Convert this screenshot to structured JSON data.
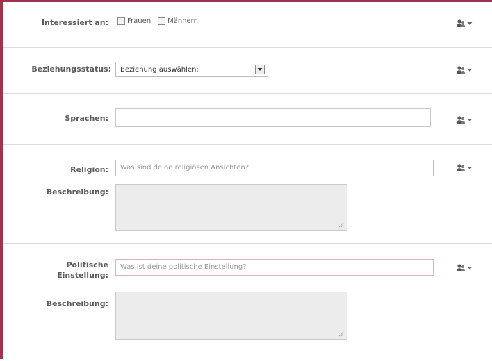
{
  "interested_in": {
    "label": "Interessiert an:",
    "options": [
      {
        "label": "Frauen",
        "checked": false
      },
      {
        "label": "Männern",
        "checked": false
      }
    ]
  },
  "relationship": {
    "label": "Beziehungsstatus:",
    "selected": "Beziehung auswählen:"
  },
  "languages": {
    "label": "Sprachen:",
    "value": ""
  },
  "religion": {
    "label": "Religion:",
    "placeholder": "Was sind deine religiösen Ansichten?",
    "description_label": "Beschreibung:"
  },
  "politics": {
    "label_line1": "Politische",
    "label_line2": "Einstellung:",
    "placeholder": "Was ist deine politische Einstellung?",
    "description_label": "Beschreibung:"
  },
  "icons": {
    "privacy": "person-icon",
    "dropdown": "chevron-down-icon"
  },
  "colors": {
    "frame": "#a0334f",
    "label": "#5a5a5a",
    "textarea_bg": "#ececec"
  }
}
